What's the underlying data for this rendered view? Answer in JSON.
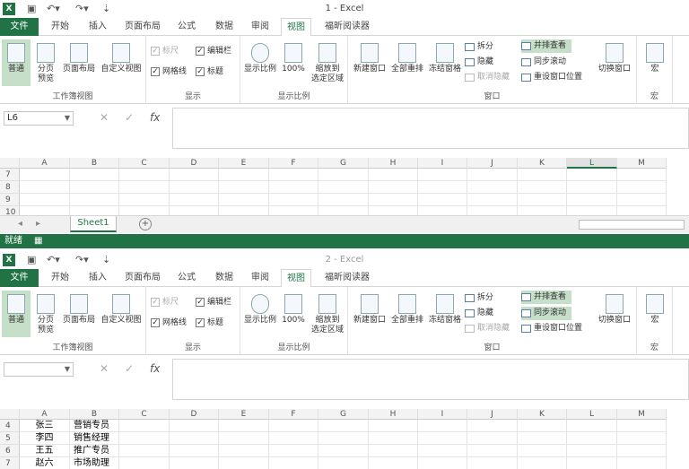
{
  "window1": {
    "title": "1 - Excel",
    "name_box": "L6",
    "rows": [
      "7",
      "8",
      "9",
      "10"
    ],
    "sheet_tab": "Sheet1",
    "status": "就绪",
    "selected_col": "L"
  },
  "window2": {
    "title": "2 - Excel",
    "name_box": "",
    "rows": [
      "4",
      "5",
      "6",
      "7"
    ],
    "cells": [
      {
        "a": "张三",
        "b": "营销专员"
      },
      {
        "a": "李四",
        "b": "销售经理"
      },
      {
        "a": "王五",
        "b": "推广专员"
      },
      {
        "a": "赵六",
        "b": "市场助理"
      }
    ]
  },
  "tabs": [
    "文件",
    "开始",
    "插入",
    "页面布局",
    "公式",
    "数据",
    "审阅",
    "视图",
    "福昕阅读器"
  ],
  "ribbon": {
    "workbook_views": {
      "label": "工作簿视图",
      "normal": "普通",
      "page_break": "分页\n预览",
      "page_layout": "页面布局",
      "custom": "自定义视图"
    },
    "show": {
      "label": "显示",
      "ruler": "标尺",
      "gridlines": "网格线",
      "formula_bar": "编辑栏",
      "headings": "标题"
    },
    "zoom": {
      "label": "显示比例",
      "zoom": "显示比例",
      "hundred": "100%",
      "to_selection": "缩放到\n选定区域"
    },
    "window": {
      "label": "窗口",
      "new_window": "新建窗口",
      "arrange_all": "全部重排",
      "freeze": "冻结窗格",
      "split": "拆分",
      "hide": "隐藏",
      "unhide": "取消隐藏",
      "side_by_side": "并排查看",
      "sync_scroll": "同步滚动",
      "reset_position": "重设窗口位置",
      "switch": "切换窗口"
    },
    "macros": {
      "label": "宏",
      "macros": "宏"
    }
  },
  "columns": [
    "A",
    "B",
    "C",
    "D",
    "E",
    "F",
    "G",
    "H",
    "I",
    "J",
    "K",
    "L",
    "M"
  ],
  "colors": {
    "accent": "#217346",
    "selected": "#c6dfc9"
  }
}
